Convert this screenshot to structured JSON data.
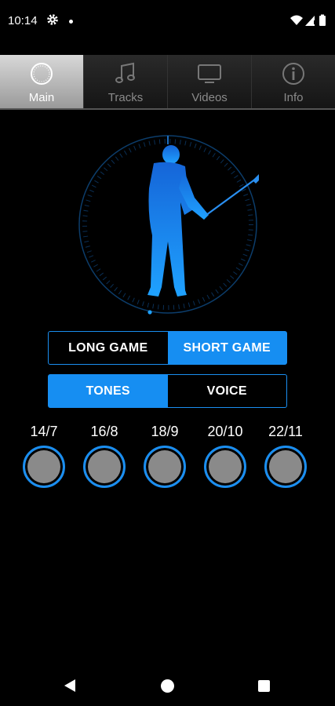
{
  "status": {
    "time": "10:14"
  },
  "tabs": [
    {
      "label": "Main",
      "icon": "dial-icon",
      "active": true
    },
    {
      "label": "Tracks",
      "icon": "music-note-icon",
      "active": false
    },
    {
      "label": "Videos",
      "icon": "tv-icon",
      "active": false
    },
    {
      "label": "Info",
      "icon": "info-icon",
      "active": false
    }
  ],
  "game_mode": {
    "options": [
      "LONG GAME",
      "SHORT GAME"
    ],
    "selected": "SHORT GAME"
  },
  "audio_mode": {
    "options": [
      "TONES",
      "VOICE"
    ],
    "selected": "TONES"
  },
  "tempos": [
    "14/7",
    "16/8",
    "18/9",
    "20/10",
    "22/11"
  ],
  "colors": {
    "accent": "#168ef2",
    "background": "#000000",
    "tempo_button": "#8a8a8a"
  }
}
